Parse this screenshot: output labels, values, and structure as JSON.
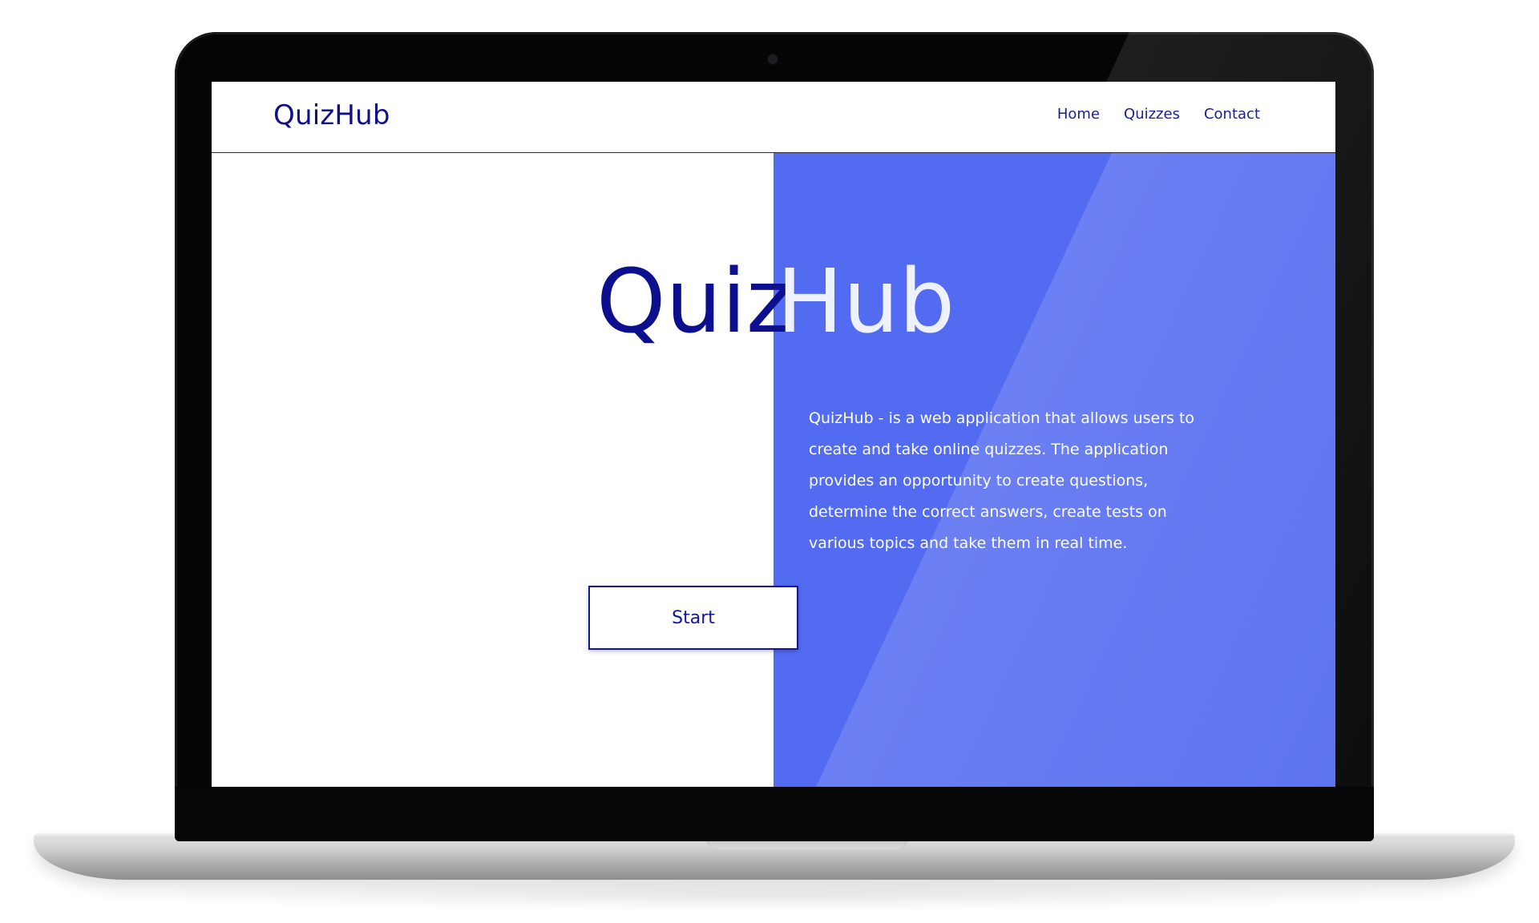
{
  "nav": {
    "brand": "QuizHub",
    "links": [
      {
        "label": "Home"
      },
      {
        "label": "Quizzes"
      },
      {
        "label": "Contact"
      }
    ]
  },
  "hero": {
    "title_part1": "Quiz",
    "title_part2": "Hub",
    "description": "QuizHub - is a web application that allows users to create and take online quizzes. The application provides an opportunity to create questions, determine the correct answers, create tests on various topics and take them in real time.",
    "start_label": "Start"
  },
  "colors": {
    "brand": "#0c0f8e",
    "accent_panel": "#536bf0",
    "background": "#ffffff"
  }
}
